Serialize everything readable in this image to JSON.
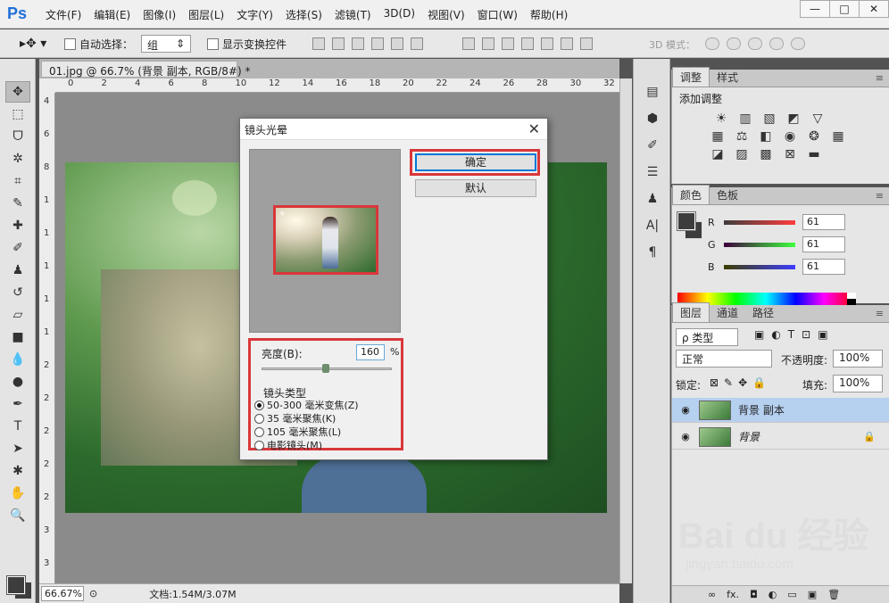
{
  "app": {
    "logo": "Ps",
    "menu": [
      "文件(F)",
      "编辑(E)",
      "图像(I)",
      "图层(L)",
      "文字(Y)",
      "选择(S)",
      "滤镜(T)",
      "3D(D)",
      "视图(V)",
      "窗口(W)",
      "帮助(H)"
    ],
    "window_buttons": {
      "minimize": "—",
      "maximize": "□",
      "close": "✕"
    }
  },
  "options_bar": {
    "auto_select_label": "自动选择：",
    "auto_select_value": "组",
    "show_transform_label": "显示变换控件",
    "mode_3d_label": "3D 模式："
  },
  "document": {
    "tab_title": "01.jpg @ 66.7% (背景 副本, RGB/8#) *",
    "ruler_top": [
      "0",
      "2",
      "4",
      "6",
      "8",
      "10",
      "12",
      "14",
      "16",
      "18",
      "20",
      "22",
      "24",
      "26",
      "28",
      "30",
      "32"
    ],
    "ruler_left": [
      "4",
      "6",
      "8",
      "1",
      "1",
      "1",
      "1",
      "1",
      "2",
      "2",
      "2",
      "2",
      "2",
      "3",
      "3"
    ],
    "zoom": "66.67%",
    "doc_info": "文档:1.54M/3.07M"
  },
  "dialog": {
    "title": "镜头光晕",
    "ok_label": "确定",
    "reset_label": "默认",
    "brightness_label": "亮度(B):",
    "brightness_value": "160",
    "percent": "%",
    "lens_type_title": "镜头类型",
    "lens_options": [
      {
        "label": "50-300 毫米变焦(Z)",
        "checked": true
      },
      {
        "label": "35 毫米聚焦(K)",
        "checked": false
      },
      {
        "label": "105 毫米聚焦(L)",
        "checked": false
      },
      {
        "label": "电影镜头(M)",
        "checked": false
      }
    ],
    "crosshair": "+"
  },
  "panels": {
    "adjust_tabs": [
      "调整",
      "样式"
    ],
    "adjust_title": "添加调整",
    "color_tabs": [
      "颜色",
      "色板"
    ],
    "color": {
      "r_label": "R",
      "g_label": "G",
      "b_label": "B",
      "r": "61",
      "g": "61",
      "b": "61"
    },
    "layers_tabs": [
      "图层",
      "通道",
      "路径"
    ],
    "layers": {
      "filter": "ρ 类型",
      "blend_mode": "正常",
      "opacity_label": "不透明度:",
      "opacity": "100%",
      "lock_label": "锁定:",
      "fill_label": "填充:",
      "fill": "100%",
      "items": [
        {
          "name": "背景 副本",
          "selected": true
        },
        {
          "name": "背景",
          "selected": false,
          "locked": true
        }
      ],
      "footer": [
        "∞",
        "fx.",
        "◘",
        "◐",
        "▭",
        "▣",
        "🗑"
      ]
    }
  },
  "watermark": {
    "brand": "Bai du 经验",
    "url": "jingyan.baidu.com"
  }
}
